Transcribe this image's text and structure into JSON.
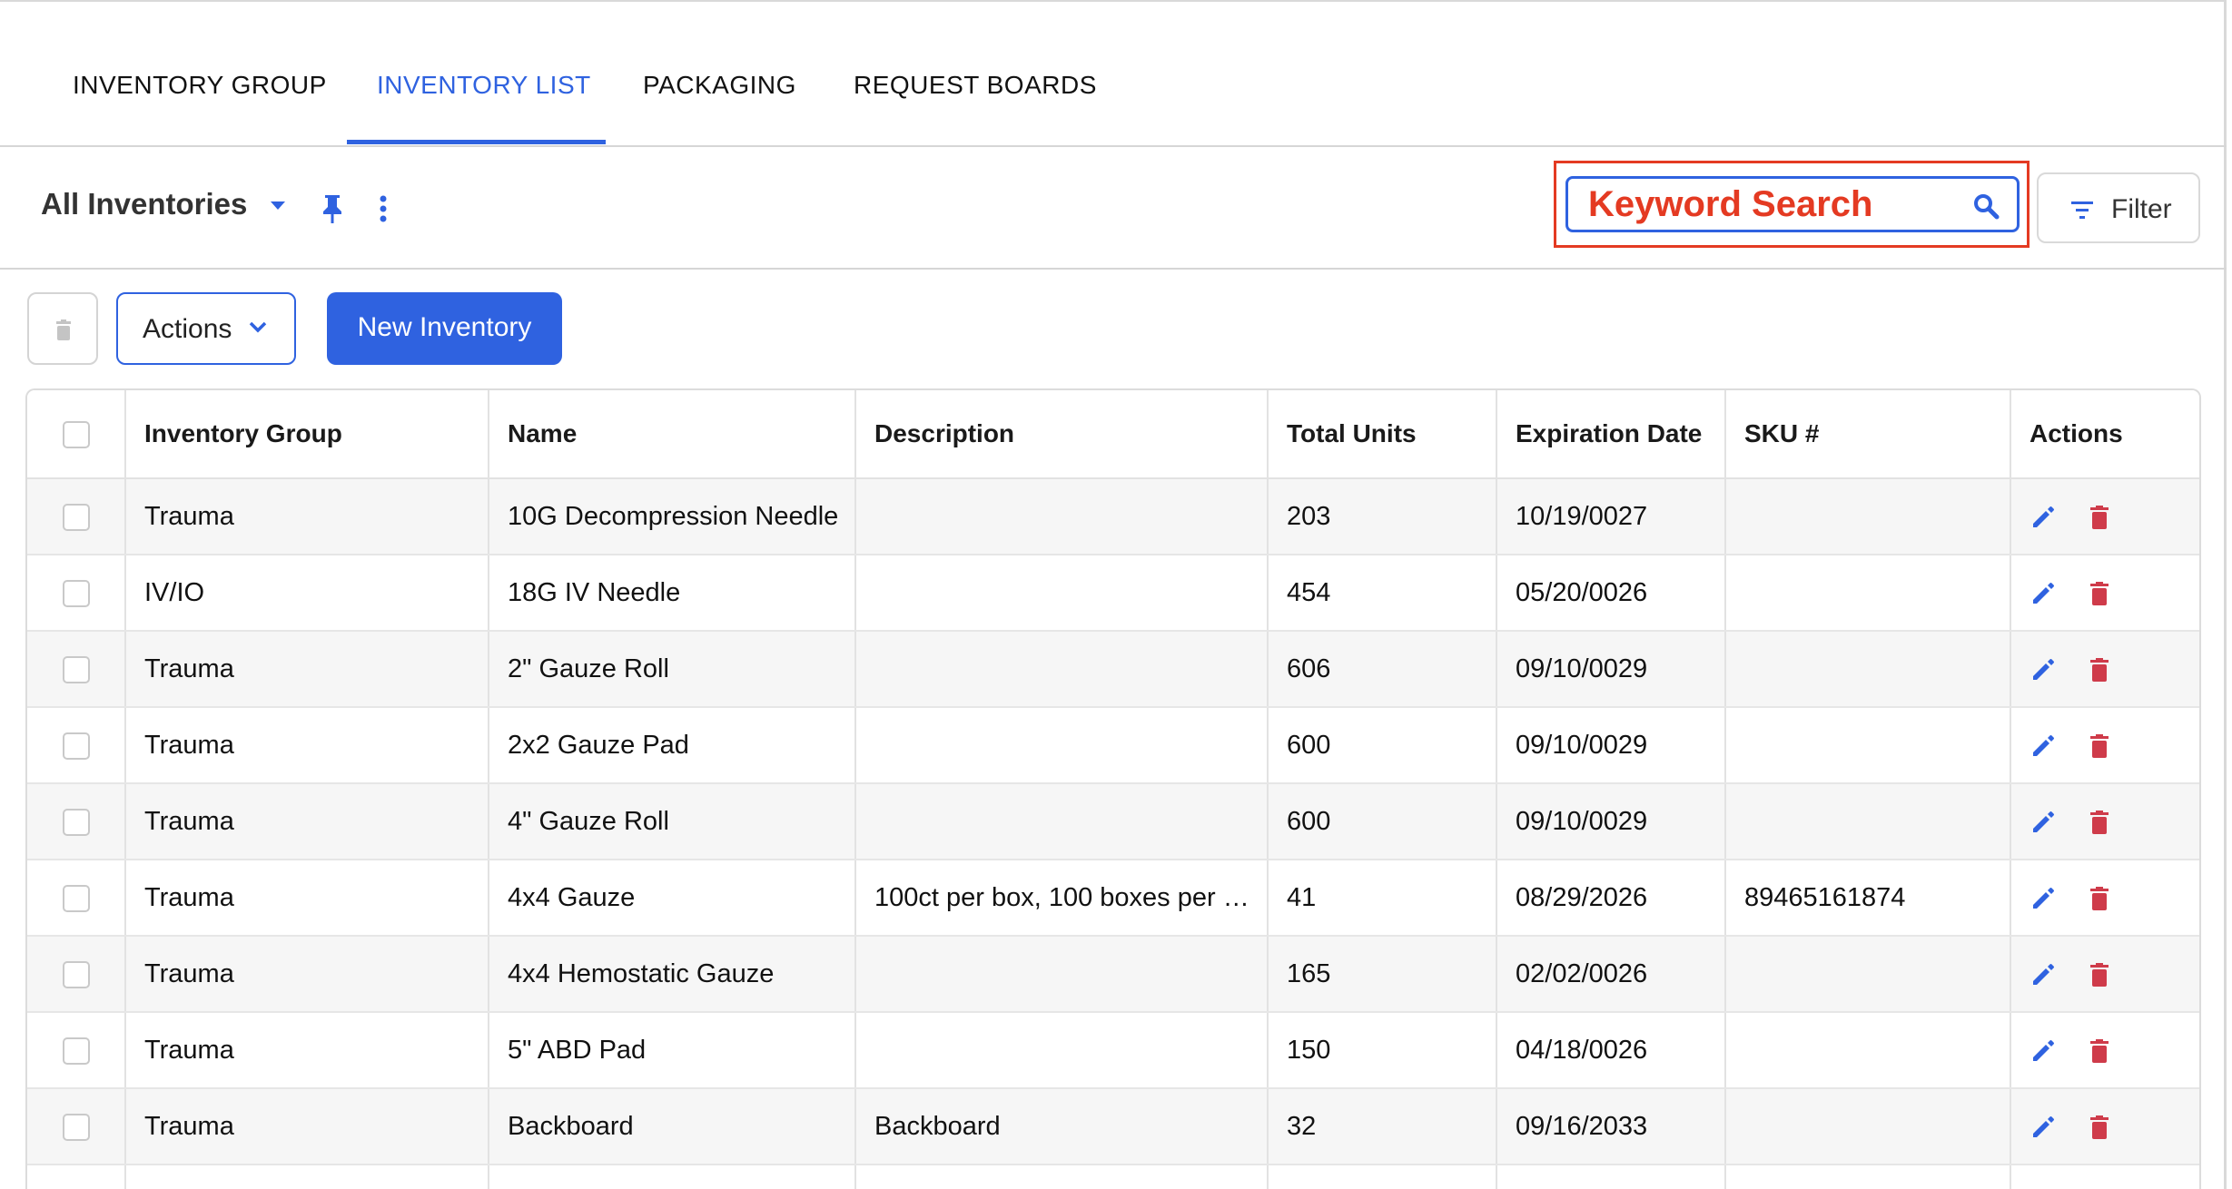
{
  "tabs": [
    {
      "label": "INVENTORY GROUP"
    },
    {
      "label": "INVENTORY LIST"
    },
    {
      "label": "PACKAGING"
    },
    {
      "label": "REQUEST BOARDS"
    }
  ],
  "active_tab": "INVENTORY LIST",
  "toolbar": {
    "view_title": "All Inventories",
    "search_placeholder": "Keyword Search",
    "filter_label": "Filter"
  },
  "actions_row": {
    "actions_label": "Actions",
    "new_label": "New Inventory"
  },
  "table": {
    "columns": [
      "Inventory Group",
      "Name",
      "Description",
      "Total Units",
      "Expiration Date",
      "SKU #",
      "Actions"
    ],
    "rows": [
      {
        "group": "Trauma",
        "name": "10G Decompression Needle",
        "description": "",
        "units": "203",
        "expiration": "10/19/0027",
        "sku": ""
      },
      {
        "group": "IV/IO",
        "name": "18G IV Needle",
        "description": "",
        "units": "454",
        "expiration": "05/20/0026",
        "sku": ""
      },
      {
        "group": "Trauma",
        "name": "2\" Gauze Roll",
        "description": "",
        "units": "606",
        "expiration": "09/10/0029",
        "sku": ""
      },
      {
        "group": "Trauma",
        "name": "2x2 Gauze Pad",
        "description": "",
        "units": "600",
        "expiration": "09/10/0029",
        "sku": ""
      },
      {
        "group": "Trauma",
        "name": "4\" Gauze Roll",
        "description": "",
        "units": "600",
        "expiration": "09/10/0029",
        "sku": ""
      },
      {
        "group": "Trauma",
        "name": "4x4 Gauze",
        "description": "100ct per box, 100 boxes per …",
        "units": "41",
        "expiration": "08/29/2026",
        "sku": "89465161874"
      },
      {
        "group": "Trauma",
        "name": "4x4 Hemostatic Gauze",
        "description": "",
        "units": "165",
        "expiration": "02/02/0026",
        "sku": ""
      },
      {
        "group": "Trauma",
        "name": "5\" ABD Pad",
        "description": "",
        "units": "150",
        "expiration": "04/18/0026",
        "sku": ""
      },
      {
        "group": "Trauma",
        "name": "Backboard",
        "description": "Backboard",
        "units": "32",
        "expiration": "09/16/2033",
        "sku": ""
      },
      {
        "group": "",
        "name": "",
        "description": "",
        "units": "",
        "expiration": "",
        "sku": ""
      }
    ]
  },
  "colors": {
    "accent": "#2f62e0",
    "highlight": "#e43a22",
    "delete": "#cf3b4a"
  }
}
